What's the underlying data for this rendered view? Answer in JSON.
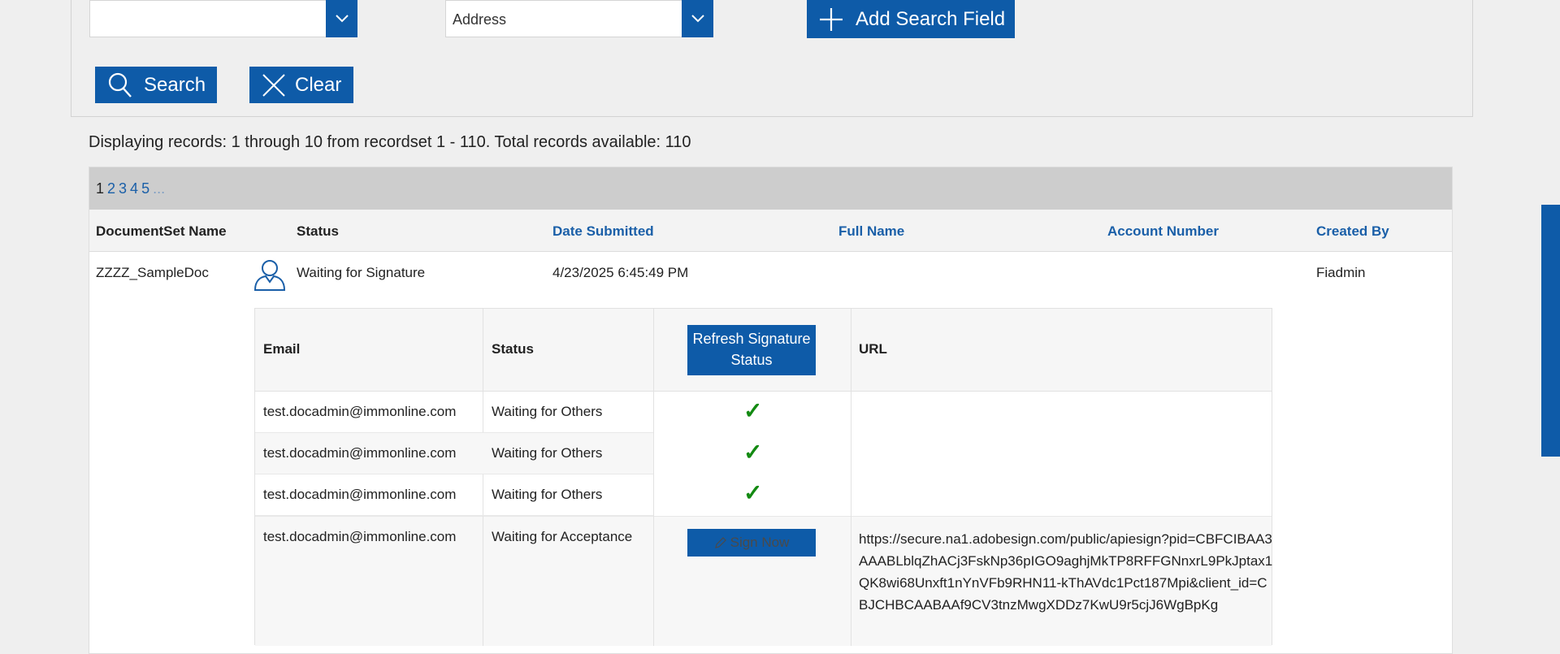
{
  "search": {
    "field_select_value": "",
    "type_select_value": "Address",
    "add_field_label": "Add Search Field",
    "search_label": "Search",
    "clear_label": "Clear"
  },
  "results": {
    "records_text": "Displaying records: 1 through 10 from recordset 1 - 110. Total records available: 110",
    "pager": {
      "current": "1",
      "pages": [
        "2",
        "3",
        "4",
        "5"
      ],
      "more": "..."
    },
    "columns": {
      "documentset_name": "DocumentSet Name",
      "status": "Status",
      "date_submitted": "Date Submitted",
      "full_name": "Full Name",
      "account_number": "Account Number",
      "created_by": "Created By"
    },
    "row": {
      "documentset_name": "ZZZZ_SampleDoc",
      "status": "Waiting for Signature",
      "date_submitted": "4/23/2025 6:45:49 PM",
      "full_name": "",
      "account_number": "",
      "created_by": "Fiadmin"
    },
    "signers": {
      "headers": {
        "email": "Email",
        "status": "Status",
        "refresh": "Refresh Signature Status",
        "url": "URL"
      },
      "rows": [
        {
          "email": "test.docadmin@immonline.com",
          "status": "Waiting for Others"
        },
        {
          "email": "test.docadmin@immonline.com",
          "status": "Waiting for Others"
        },
        {
          "email": "test.docadmin@immonline.com",
          "status": "Waiting for Others"
        },
        {
          "email": "test.docadmin@immonline.com",
          "status": "Waiting for Acceptance"
        }
      ],
      "sign_now_label": "Sign Now",
      "url": "https://secure.na1.adobesign.com/public/apiesign?pid=CBFCIBAA3AAABLblqZhACj3FskNp36pIGO9aghjMkTP8RFFGNnxrL9PkJptax1QK8wi68Unxft1nYnVFb9RHN11-kThAVdc1Pct187Mpi&client_id=CBJCHBCAABAAf9CV3tnzMwgXDDz7KwU9r5cjJ6WgBpKg"
    }
  },
  "icons": {
    "dropdown": "chevron-down-icon",
    "add": "plus-icon",
    "search": "search-icon",
    "clear": "close-icon",
    "person": "user-icon",
    "check": "checkmark-icon",
    "pencil": "pencil-icon"
  },
  "colors": {
    "accent": "#0e5ba8",
    "link": "#1a5fa8",
    "check": "#138a12",
    "pager_bg": "#cdcdcd"
  }
}
